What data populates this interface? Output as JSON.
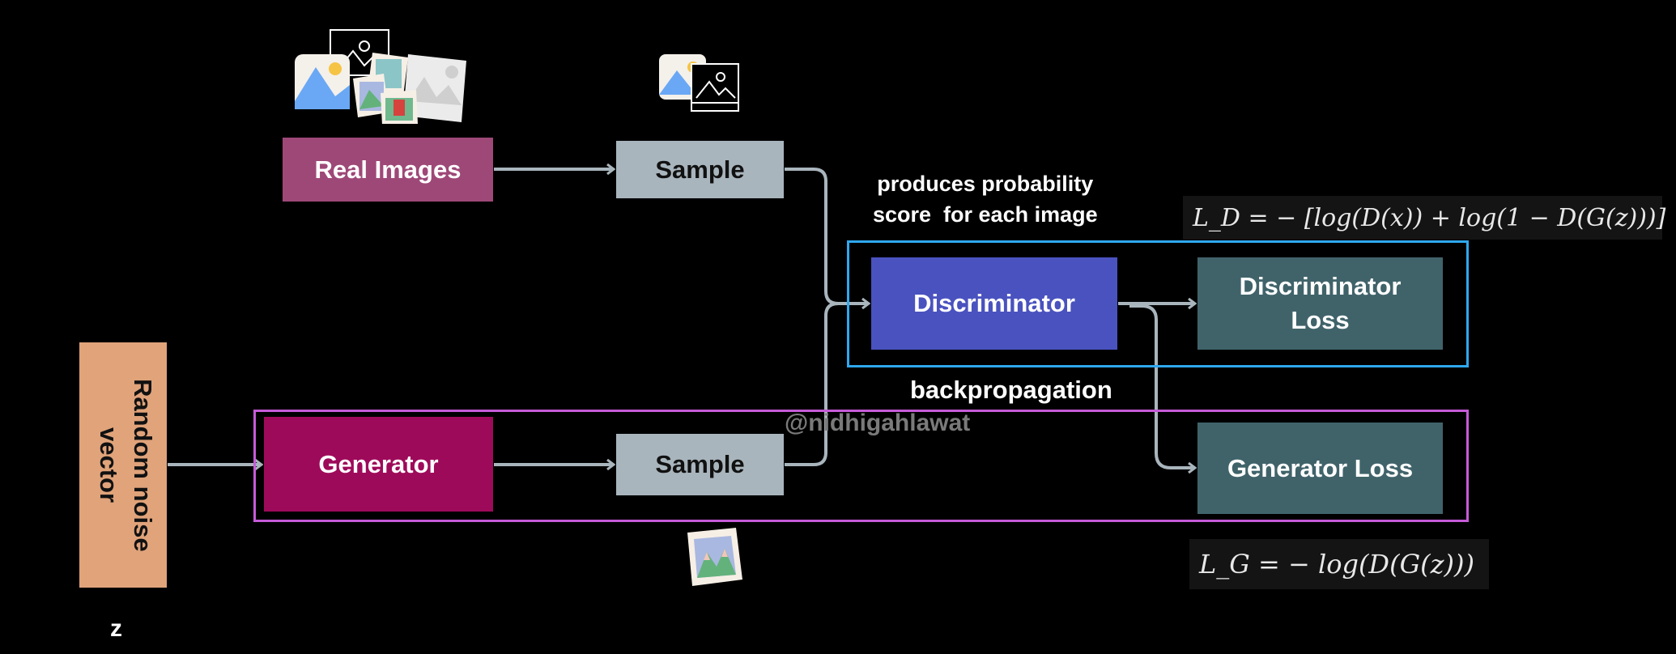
{
  "colors": {
    "real_images": "#9e4878",
    "sample": "#a9b5bd",
    "random_noise": "#e0a37a",
    "generator": "#9e0a5a",
    "discriminator": "#4a52bf",
    "loss": "#40636a",
    "discriminator_frame": "#2fa8f0",
    "generator_frame": "#c65bd8",
    "arrow": "#a9b5bd"
  },
  "nodes": {
    "real_images": "Real Images",
    "sample_real": "Sample",
    "random_noise": "Random noise vector",
    "z_label": "z",
    "generator": "Generator",
    "sample_fake": "Sample",
    "discriminator": "Discriminator",
    "discriminator_loss": "Discriminator Loss",
    "generator_loss": "Generator Loss"
  },
  "annotations": {
    "probability_line1": "produces probability",
    "probability_line2": "score  for each image",
    "backpropagation": "backpropagation",
    "watermark": "@nidhigahlawat"
  },
  "formulas": {
    "discriminator_loss": "L_D = − [log(D(x)) + log(1 − D(G(z)))]",
    "generator_loss": "L_G = − log(D(G(z)))"
  },
  "icons": [
    "image-stack-icon",
    "image-pair-icon",
    "generated-image-icon"
  ]
}
